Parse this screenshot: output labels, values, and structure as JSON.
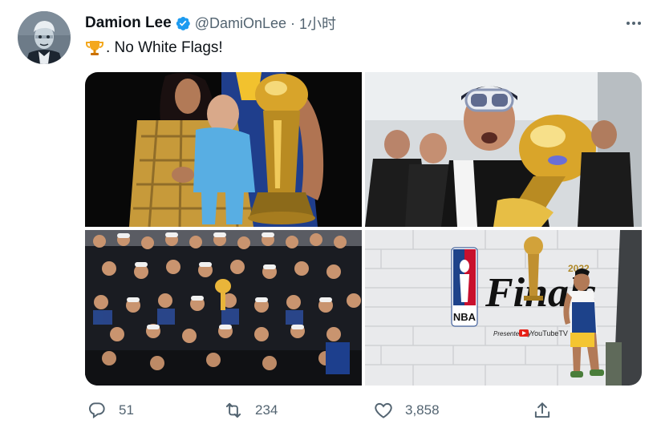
{
  "tweet": {
    "display_name": "Damion Lee",
    "handle": "@DamiOnLee",
    "separator": "·",
    "time": "1小时",
    "text": ". No White Flags!",
    "text_emoji_icon": "trophy-icon",
    "more_icon": "more-icon"
  },
  "media": [
    {
      "name": "photo-family-trophy",
      "description_icon": "photo"
    },
    {
      "name": "photo-goggles-trophy",
      "description_icon": "photo"
    },
    {
      "name": "photo-team-celebration",
      "description_icon": "photo"
    },
    {
      "name": "photo-finals-wall",
      "description_icon": "photo",
      "wall_text": "Finals",
      "wall_year": "2022",
      "wall_nba": "NBA",
      "wall_presented": "Presented by",
      "wall_sponsor": "YouTubeTV"
    }
  ],
  "actions": {
    "reply_count": "51",
    "retweet_count": "234",
    "like_count": "3,858"
  },
  "colors": {
    "text_primary": "#0f1419",
    "text_secondary": "#536471",
    "verified_blue": "#1d9bf0"
  }
}
